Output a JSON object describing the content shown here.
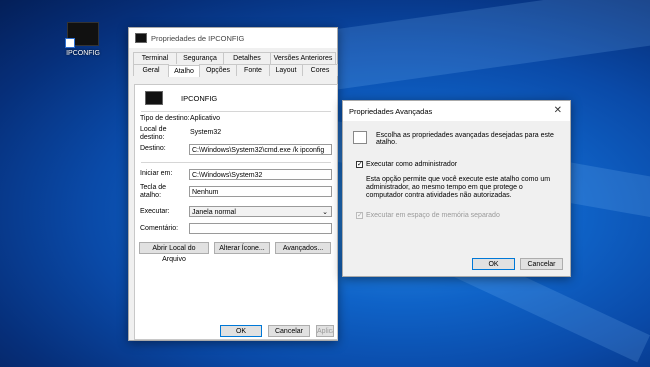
{
  "desktop": {
    "icon_label": "IPCONFIG"
  },
  "props": {
    "title": "Propriedades de IPCONFIG",
    "tabs_top": [
      "Terminal",
      "Segurança",
      "Detalhes",
      "Versões Anteriores"
    ],
    "tabs_bottom": [
      "Geral",
      "Atalho",
      "Opções",
      "Fonte",
      "Layout",
      "Cores"
    ],
    "name": "IPCONFIG",
    "tipo_label": "Tipo de destino:",
    "tipo_value": "Aplicativo",
    "local_label": "Local de destino:",
    "local_value": "System32",
    "destino_label": "Destino:",
    "destino_value": "C:\\Windows\\System32\\cmd.exe /k ipconfig",
    "iniciar_label": "Iniciar em:",
    "iniciar_value": "C:\\Windows\\System32",
    "tecla_label": "Tecla de atalho:",
    "tecla_value": "Nenhum",
    "executar_label": "Executar:",
    "executar_value": "Janela normal",
    "comentario_label": "Comentário:",
    "comentario_value": "",
    "btn_abrir": "Abrir Local do Arquivo",
    "btn_icone": "Alterar Ícone...",
    "btn_avancados": "Avançados...",
    "btn_ok": "OK",
    "btn_cancelar": "Cancelar",
    "btn_aplicar": "Aplicar"
  },
  "adv": {
    "title": "Propriedades Avançadas",
    "intro": "Escolha as propriedades avançadas desejadas para este atalho.",
    "checkbox1_label": "Executar como administrador",
    "checkbox1_checked": true,
    "description": "Esta opção permite que você execute este atalho como um administrador, ao mesmo tempo em que protege o computador contra atividades não autorizadas.",
    "checkbox2_label": "Executar em espaço de memória separado",
    "checkbox2_checked": true,
    "btn_ok": "OK",
    "btn_cancelar": "Cancelar"
  }
}
